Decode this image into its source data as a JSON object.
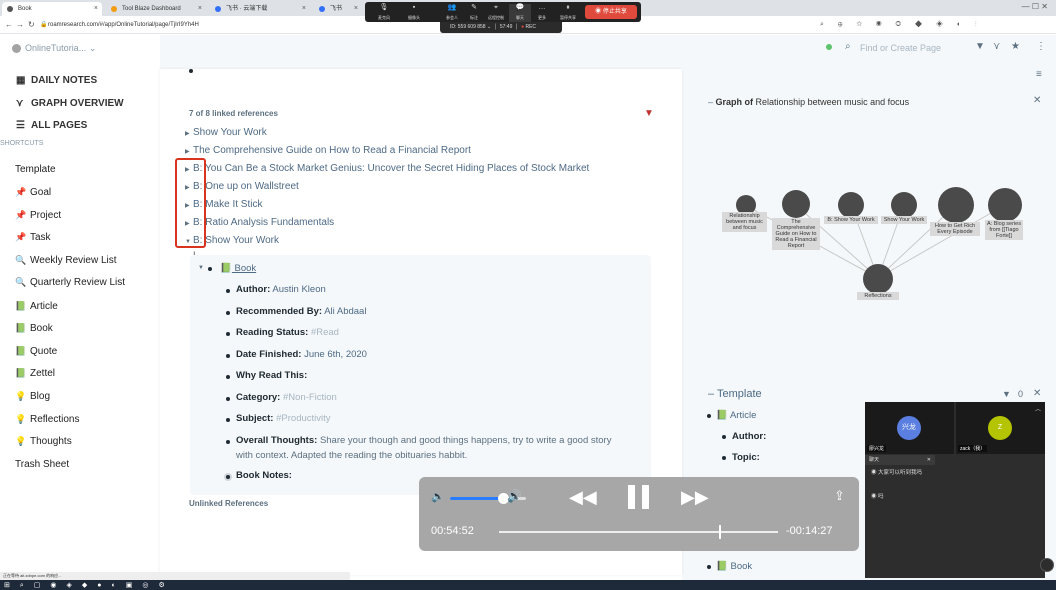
{
  "browser": {
    "tabs": [
      {
        "label": "Book",
        "active": true
      },
      {
        "label": "Tool Blaze Dashboard",
        "active": false
      },
      {
        "label": "飞书 · 云端下载",
        "active": false
      },
      {
        "label": "飞书",
        "active": false
      }
    ],
    "url": "roamresearch.com/#/app/OnlineTutorial/page/TjIrI9Yh4H"
  },
  "meeting": {
    "buttons": [
      "麦克风",
      "摄像头",
      "参会人",
      "标注",
      "远程控制",
      "聊天",
      "更多",
      "暂停共享"
    ],
    "participant_count": "4",
    "stop_share": "停止共享",
    "meeting_id": "ID: 559 609 858",
    "time": "57:49",
    "rec": "REC"
  },
  "graph_name": "OnlineTutoria...",
  "toolbar": {
    "search_placeholder": "Find or Create Page"
  },
  "sidebar": {
    "nav": [
      {
        "icon": "calendar-icon",
        "label": "DAILY NOTES"
      },
      {
        "icon": "graph-icon",
        "label": "GRAPH OVERVIEW"
      },
      {
        "icon": "list-icon",
        "label": "ALL PAGES"
      }
    ],
    "shortcuts_label": "SHORTCUTS",
    "shortcuts": [
      {
        "label": "Template",
        "icon": ""
      },
      {
        "label": "Goal",
        "icon": "📌"
      },
      {
        "label": "Project",
        "icon": "📌"
      },
      {
        "label": "Task",
        "icon": "📌"
      },
      {
        "label": "Weekly Review List",
        "icon": "🔍"
      },
      {
        "label": "Quarterly Review List",
        "icon": "🔍"
      },
      {
        "label": "Article",
        "icon": "📗"
      },
      {
        "label": "Book",
        "icon": "📗"
      },
      {
        "label": "Quote",
        "icon": "📗"
      },
      {
        "label": "Zettel",
        "icon": "📗"
      },
      {
        "label": "Blog",
        "icon": "💡"
      },
      {
        "label": "Reflections",
        "icon": "💡"
      },
      {
        "label": "Thoughts",
        "icon": "💡"
      },
      {
        "label": "Trash Sheet",
        "icon": ""
      }
    ]
  },
  "main": {
    "linked_refs_label": "7 of 8 linked references",
    "refs": [
      "Show Your Work",
      "The Comprehensive Guide on How to Read a Financial Report",
      "B: You Can Be a Stock Market Genius: Uncover the Secret Hiding Places of Stock Market",
      "B: One up on Wallstreet",
      "B: Make It Stick",
      "B: Ratio Analysis Fundamentals",
      "B: Show Your Work"
    ],
    "child_page": "Book",
    "attributes": [
      {
        "key": "Author:",
        "value": "Austin Kleon",
        "style": "lk"
      },
      {
        "key": "Recommended By:",
        "value": "Ali Abdaal",
        "style": "lk"
      },
      {
        "key": "Reading Status:",
        "value": "#Read",
        "style": "tg"
      },
      {
        "key": "Date Finished:",
        "value": "June 6th, 2020",
        "style": "lk"
      },
      {
        "key": "Why Read This:",
        "value": "",
        "style": "v"
      },
      {
        "key": "Category:",
        "value": "#Non-Fiction",
        "style": "tg"
      },
      {
        "key": "Subject:",
        "value": "#Productivity",
        "style": "tg"
      },
      {
        "key": "Overall Thoughts:",
        "value": "Share your though and good things happens, try to write a good story",
        "style": "v"
      },
      {
        "key": "Book Notes:",
        "value": "",
        "style": "v"
      }
    ],
    "overall_thoughts_line2": "with context. Adapted the reading the obituaries habbit.",
    "unlinked_label": "Unlinked References"
  },
  "right": {
    "graph_title_prefix": "Graph of",
    "graph_title": "Relationship between music and focus",
    "graph_nodes": [
      "Relationship between music and focus",
      "The Comprehensive Guide on How to Read a Financial Report",
      "B: Show Your Work",
      "Show Your Work",
      "How to Get Rich Every Episode",
      "A: Blog series from [[Tiago Forte]]",
      "Reflections"
    ],
    "template_title": "Template",
    "template_filter_count": "0",
    "template_items": [
      {
        "label": "Article"
      },
      {
        "label": "Author:"
      },
      {
        "label": "Topic:"
      },
      {
        "label": "Book"
      }
    ]
  },
  "video": {
    "elapsed": "00:54:52",
    "remaining": "-00:14:27",
    "progress": 0.79,
    "volume": 0.7
  },
  "chat": {
    "participants": [
      {
        "name": "廖兴龙",
        "avatar_text": "兴龙",
        "color": "#5b7fe0"
      },
      {
        "name": "zack（我）",
        "avatar_text": "Z",
        "color": "#b5c400"
      }
    ],
    "header": "聊天",
    "messages": [
      {
        "text": "大家可以听到我吗"
      },
      {
        "text": "吗"
      }
    ]
  },
  "statusbar": "正在等待 ait.zdnpe.com 的响应..."
}
